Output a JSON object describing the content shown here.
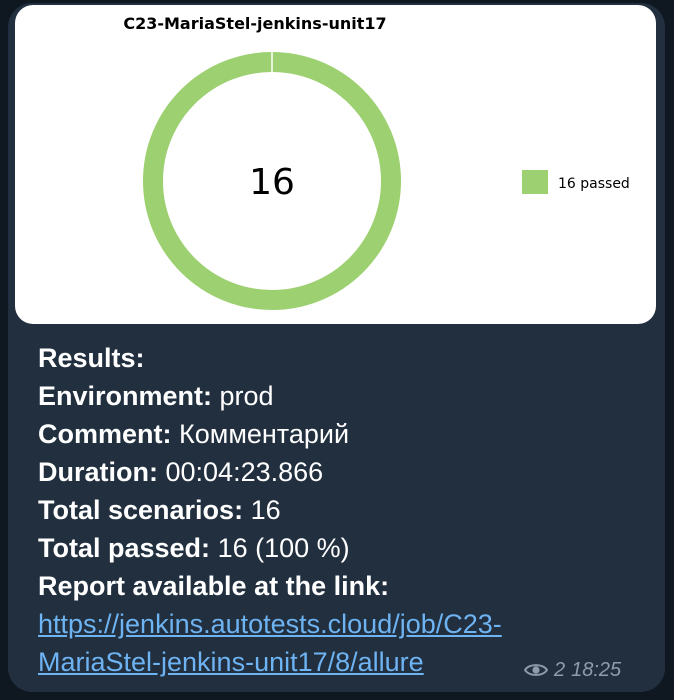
{
  "chart": {
    "title": "C23-MariaStel-jenkins-unit17",
    "center_value": "16",
    "legend_label": "16 passed",
    "colors": {
      "passed": "#9dd071"
    }
  },
  "chart_data": {
    "type": "pie",
    "title": "C23-MariaStel-jenkins-unit17",
    "categories": [
      "passed"
    ],
    "values": [
      16
    ],
    "legend": [
      "16 passed"
    ],
    "legend_position": "right"
  },
  "message": {
    "results_label": "Results:",
    "environment_label": "Environment:",
    "environment_value": "prod",
    "comment_label": "Comment:",
    "comment_value": "Комментарий",
    "duration_label": "Duration:",
    "duration_value": "00:04:23.866",
    "total_scenarios_label": "Total scenarios:",
    "total_scenarios_value": "16",
    "total_passed_label": "Total passed:",
    "total_passed_value": "16 (100 %)",
    "report_label": "Report available at the link:",
    "report_link": "https://jenkins.autotests.cloud/job/C23-MariaStel-jenkins-unit17/8/allure"
  },
  "meta": {
    "views_icon": "eye-icon",
    "views_count": "2",
    "time": "18:25"
  }
}
